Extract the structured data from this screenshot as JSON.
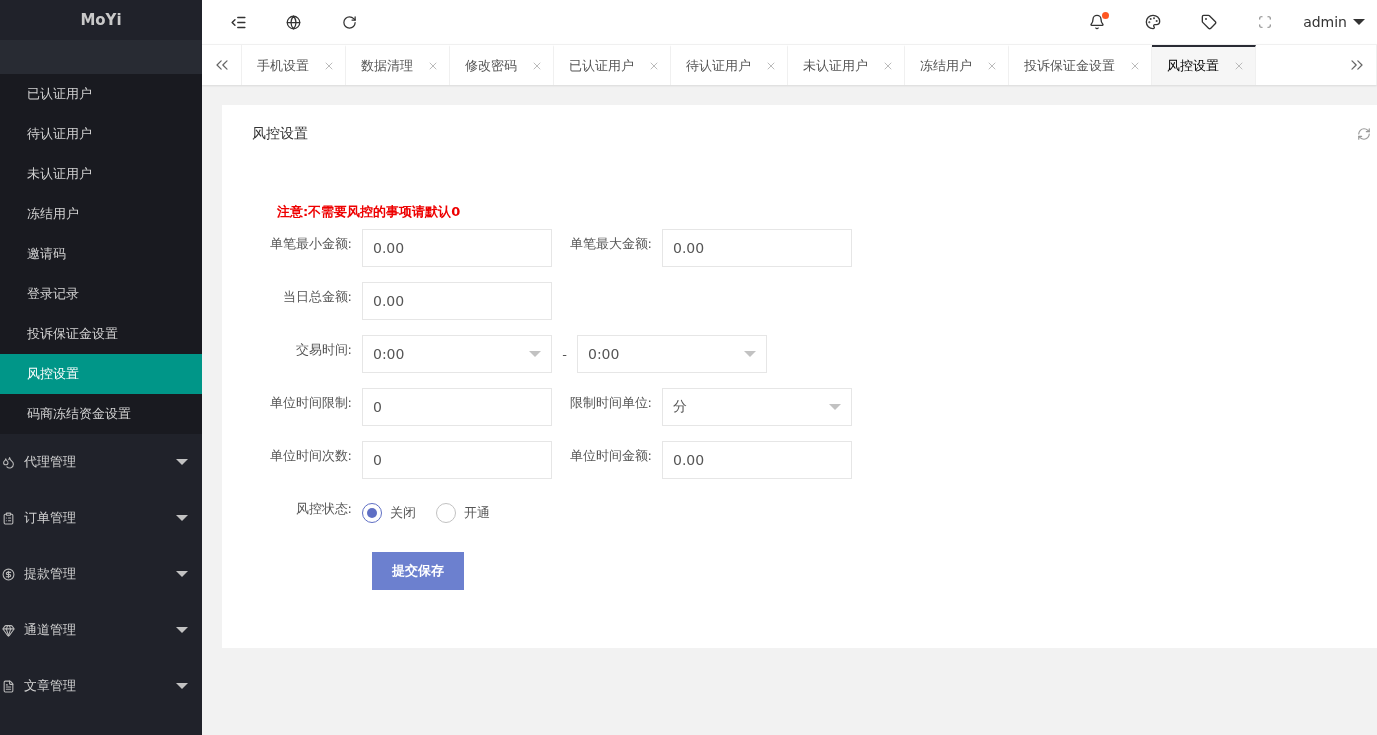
{
  "sidebar": {
    "logo": "MoYi",
    "submenu": [
      {
        "label": "已认证用户",
        "selected": false
      },
      {
        "label": "待认证用户",
        "selected": false
      },
      {
        "label": "未认证用户",
        "selected": false
      },
      {
        "label": "冻结用户",
        "selected": false
      },
      {
        "label": "邀请码",
        "selected": false
      },
      {
        "label": "登录记录",
        "selected": false
      },
      {
        "label": "投诉保证金设置",
        "selected": false
      },
      {
        "label": "风控设置",
        "selected": true
      },
      {
        "label": "码商冻结资金设置",
        "selected": false
      }
    ],
    "groups": [
      {
        "label": "代理管理",
        "expanded": false
      },
      {
        "label": "订单管理",
        "expanded": false
      },
      {
        "label": "提款管理",
        "expanded": false
      },
      {
        "label": "通道管理",
        "expanded": false
      },
      {
        "label": "文章管理",
        "expanded": false
      }
    ]
  },
  "header": {
    "notification_dot": true,
    "user": "admin"
  },
  "tabs": [
    {
      "label": "手机设置",
      "selected": false
    },
    {
      "label": "数据清理",
      "selected": false
    },
    {
      "label": "修改密码",
      "selected": false
    },
    {
      "label": "已认证用户",
      "selected": false
    },
    {
      "label": "待认证用户",
      "selected": false
    },
    {
      "label": "未认证用户",
      "selected": false
    },
    {
      "label": "冻结用户",
      "selected": false
    },
    {
      "label": "投诉保证金设置",
      "selected": false
    },
    {
      "label": "风控设置",
      "selected": true
    }
  ],
  "card": {
    "title": "风控设置",
    "notice": "注意:不需要风控的事项请默认0",
    "rows": [
      {
        "fields": [
          {
            "label": "单笔最小金额:",
            "kind": "input",
            "value": "0.00"
          },
          {
            "label": "单笔最大金额:",
            "kind": "input",
            "value": "0.00"
          }
        ]
      },
      {
        "fields": [
          {
            "label": "当日总金额:",
            "kind": "input",
            "value": "0.00"
          }
        ]
      },
      {
        "fields": [
          {
            "label": "交易时间:",
            "kind": "range",
            "from": "0:00",
            "separator": "-",
            "to": "0:00"
          }
        ]
      },
      {
        "fields": [
          {
            "label": "单位时间限制:",
            "kind": "input",
            "value": "0"
          },
          {
            "label": "限制时间单位:",
            "kind": "select",
            "value": "分"
          }
        ]
      },
      {
        "fields": [
          {
            "label": "单位时间次数:",
            "kind": "input",
            "value": "0"
          },
          {
            "label": "单位时间金额:",
            "kind": "input",
            "value": "0.00"
          }
        ]
      },
      {
        "fields": [
          {
            "label": "风控状态:",
            "kind": "radio",
            "options": [
              {
                "label": "关闭",
                "selected": true
              },
              {
                "label": "开通",
                "selected": false
              }
            ]
          }
        ]
      }
    ],
    "submit": "提交保存"
  }
}
